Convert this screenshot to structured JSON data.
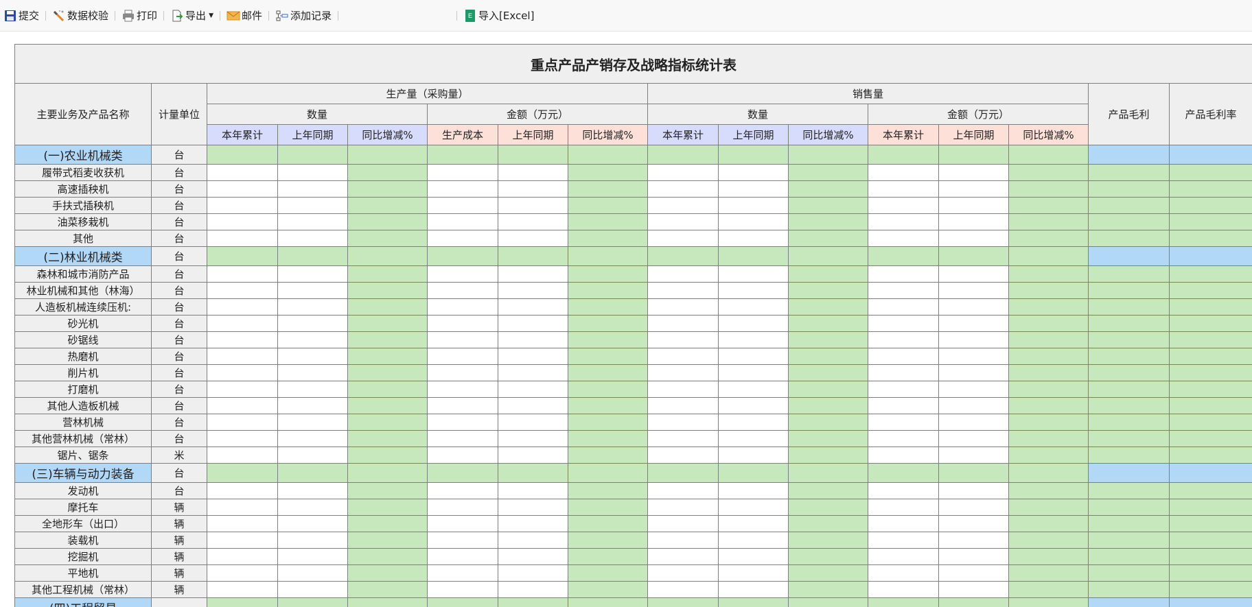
{
  "toolbar": {
    "items": [
      {
        "label": "提交",
        "icon": "save-icon"
      },
      {
        "label": "数据校验",
        "icon": "validate-icon"
      },
      {
        "label": "打印",
        "icon": "printer-icon"
      },
      {
        "label": "导出",
        "icon": "export-icon"
      },
      {
        "label": "邮件",
        "icon": "mail-icon"
      },
      {
        "label": "添加记录",
        "icon": "add-record-icon"
      },
      {
        "label": "导入[Excel]",
        "icon": "excel-icon"
      }
    ],
    "colors": {
      "excel_icon": "#1e9a6a",
      "save_icon": "#2b4aa0",
      "mail_icon": "#e8a53a"
    }
  },
  "report": {
    "title": "重点产品产销存及战略指标统计表",
    "headers": {
      "name": "主要业务及产品名称",
      "unit": "计量单位",
      "production": "生产量（采购量）",
      "sales": "销售量",
      "gross_profit": "产品毛利",
      "gross_margin": "产品毛利率",
      "quantity": "数量",
      "amount": "金额（万元）",
      "ytd": "本年累计",
      "prev": "上年同期",
      "yoy": "同比增减%",
      "cost": "生产成本"
    },
    "colors": {
      "header_bg": "#efefef",
      "category_blue": "#b2d8f8",
      "formula_green": "#c6e8bc",
      "sub_blue": "#d8dcfc",
      "sub_pink": "#fde0d8",
      "input_white": "#ffffff"
    },
    "rows": [
      {
        "name": "(一)农业机械类",
        "unit": "台",
        "type": "category"
      },
      {
        "name": "履带式稻麦收获机",
        "unit": "台",
        "type": "item"
      },
      {
        "name": "高速插秧机",
        "unit": "台",
        "type": "item"
      },
      {
        "name": "手扶式插秧机",
        "unit": "台",
        "type": "item"
      },
      {
        "name": "油菜移栽机",
        "unit": "台",
        "type": "item"
      },
      {
        "name": "其他",
        "unit": "台",
        "type": "item"
      },
      {
        "name": "(二)林业机械类",
        "unit": "台",
        "type": "category"
      },
      {
        "name": "森林和城市消防产品",
        "unit": "台",
        "type": "item"
      },
      {
        "name": "林业机械和其他（林海）",
        "unit": "台",
        "type": "item"
      },
      {
        "name": "人造板机械连续压机:",
        "unit": "台",
        "type": "item"
      },
      {
        "name": "砂光机",
        "unit": "台",
        "type": "item"
      },
      {
        "name": "砂锯线",
        "unit": "台",
        "type": "item"
      },
      {
        "name": "热磨机",
        "unit": "台",
        "type": "item"
      },
      {
        "name": "削片机",
        "unit": "台",
        "type": "item"
      },
      {
        "name": "打磨机",
        "unit": "台",
        "type": "item"
      },
      {
        "name": "其他人造板机械",
        "unit": "台",
        "type": "item"
      },
      {
        "name": "营林机械",
        "unit": "台",
        "type": "item"
      },
      {
        "name": "其他营林机械（常林）",
        "unit": "台",
        "type": "item"
      },
      {
        "name": "锯片、锯条",
        "unit": "米",
        "type": "item"
      },
      {
        "name": "(三)车辆与动力装备",
        "unit": "台",
        "type": "category"
      },
      {
        "name": "发动机",
        "unit": "台",
        "type": "item"
      },
      {
        "name": "摩托车",
        "unit": "辆",
        "type": "item"
      },
      {
        "name": "全地形车（出口）",
        "unit": "辆",
        "type": "item"
      },
      {
        "name": "装载机",
        "unit": "辆",
        "type": "item"
      },
      {
        "name": "挖掘机",
        "unit": "辆",
        "type": "item"
      },
      {
        "name": "平地机",
        "unit": "辆",
        "type": "item"
      },
      {
        "name": "其他工程机械（常林）",
        "unit": "辆",
        "type": "item"
      },
      {
        "name": "(四)工程贸易",
        "unit": "",
        "type": "category"
      }
    ]
  }
}
